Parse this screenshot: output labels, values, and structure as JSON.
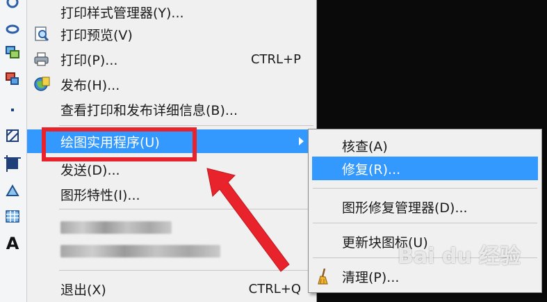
{
  "menu": {
    "items": [
      {
        "label": "打印样式管理器(Y)..."
      },
      {
        "label": "打印预览(V)"
      },
      {
        "label": "打印(P)...",
        "shortcut": "CTRL+P"
      },
      {
        "label": "发布(H)..."
      },
      {
        "label": "查看打印和发布详细信息(B)..."
      },
      {
        "label": "绘图实用程序(U)"
      },
      {
        "label": "发送(D)..."
      },
      {
        "label": "图形特性(I)..."
      },
      {
        "label": "退出(X)",
        "shortcut": "CTRL+Q"
      }
    ]
  },
  "submenu": {
    "items": [
      {
        "label": "核查(A)"
      },
      {
        "label": "修复(R)..."
      },
      {
        "label": "图形修复管理器(D)..."
      },
      {
        "label": "更新块图标(U)"
      },
      {
        "label": "清理(P)..."
      }
    ]
  },
  "toolstrip": {
    "text_tool": "A"
  },
  "watermark": {
    "text": "Bai du 经验"
  },
  "colors": {
    "highlight": "#3399ff",
    "annotation_red": "#e8232b",
    "menu_bg": "#f0f0f0"
  }
}
